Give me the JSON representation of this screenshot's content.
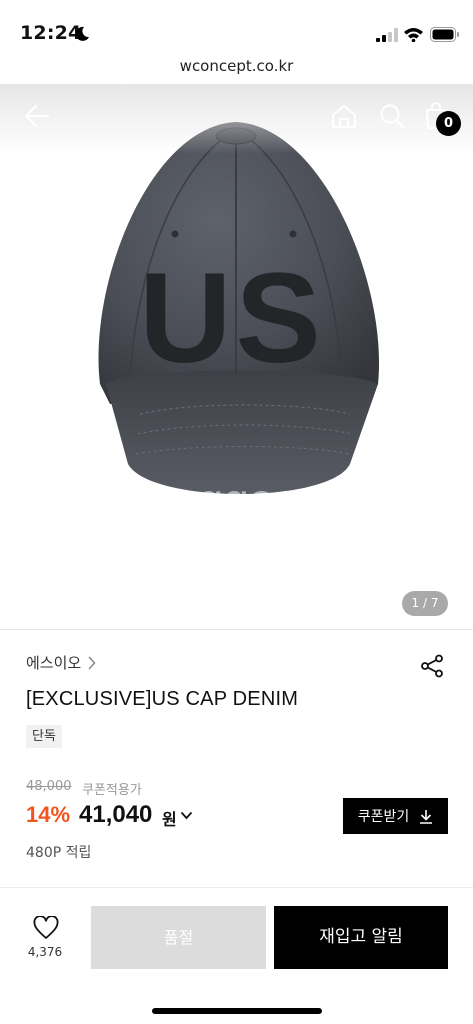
{
  "status_bar": {
    "time": "12:24",
    "icons": [
      "moon-icon",
      "signal-icon",
      "wifi-icon",
      "battery-icon"
    ]
  },
  "browser": {
    "url": "wconcept.co.kr"
  },
  "hero": {
    "nav_icons": [
      "back-arrow-icon",
      "home-icon",
      "search-icon",
      "shopping-bag-icon"
    ],
    "cart_count": "0",
    "image_indicator": "1 / 7",
    "image_subject": "dark grey denim baseball cap with embroidered US lettering",
    "cap_embroidery": "US"
  },
  "product": {
    "brand": "에스이오",
    "title": "[EXCLUSIVE]US CAP DENIM",
    "tag": "단독",
    "original_price": "48,000",
    "coupon_label": "쿠폰적용가",
    "discount_rate": "14%",
    "sale_price": "41,040",
    "currency": "원",
    "coupon_button": "쿠폰받기",
    "points": "480P 적립"
  },
  "actions": {
    "wish_count": "4,376",
    "soldout_label": "품절",
    "restock_label": "재입고 알림"
  },
  "colors": {
    "accent_discount": "#f2551d",
    "button_dark": "#000000",
    "button_disabled": "#dcdcdc",
    "cap_denim": "#4a4d55"
  }
}
